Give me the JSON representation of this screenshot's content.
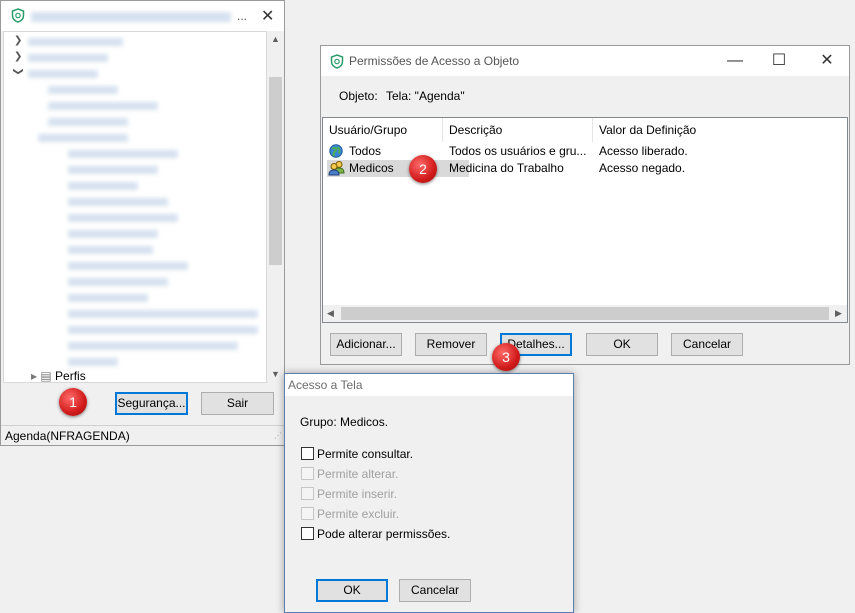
{
  "tree_window": {
    "title": "...",
    "security_button": "Segurança...",
    "exit_button": "Sair",
    "status": "Agenda(NFRAGENDA)",
    "partial_tree_label": "Perfis"
  },
  "permissions_dialog": {
    "title": "Permissões de Acesso a Objeto",
    "object_label": "Objeto:",
    "object_value": "Tela: \"Agenda\"",
    "columns": [
      "Usuário/Grupo",
      "Descrição",
      "Valor da Definição"
    ],
    "rows": [
      {
        "name": "Todos",
        "description": "Todos os usuários e gru...",
        "value": "Acesso liberado.",
        "icon": "globe-icon"
      },
      {
        "name": "Medicos",
        "description": "Medicina do Trabalho",
        "value": "Acesso negado.",
        "icon": "user-group-icon"
      }
    ],
    "buttons": {
      "add": "Adicionar...",
      "remove": "Remover",
      "details": "Detalhes...",
      "ok": "OK",
      "cancel": "Cancelar"
    }
  },
  "access_dialog": {
    "title": "Acesso a Tela",
    "group_label": "Grupo: Medicos.",
    "options": [
      {
        "label": "Permite consultar.",
        "enabled": true,
        "checked": false
      },
      {
        "label": "Permite alterar.",
        "enabled": false,
        "checked": false
      },
      {
        "label": "Permite inserir.",
        "enabled": false,
        "checked": false
      },
      {
        "label": "Permite excluir.",
        "enabled": false,
        "checked": false
      },
      {
        "label": "Pode alterar permissões.",
        "enabled": true,
        "checked": false
      }
    ],
    "ok": "OK",
    "cancel": "Cancelar"
  },
  "badges": [
    "1",
    "2",
    "3"
  ],
  "colors": {
    "selection": "#cce8ff",
    "focus_border": "#0078d7",
    "badge": "#d11a1a",
    "app_icon": "#2a9d6a"
  }
}
